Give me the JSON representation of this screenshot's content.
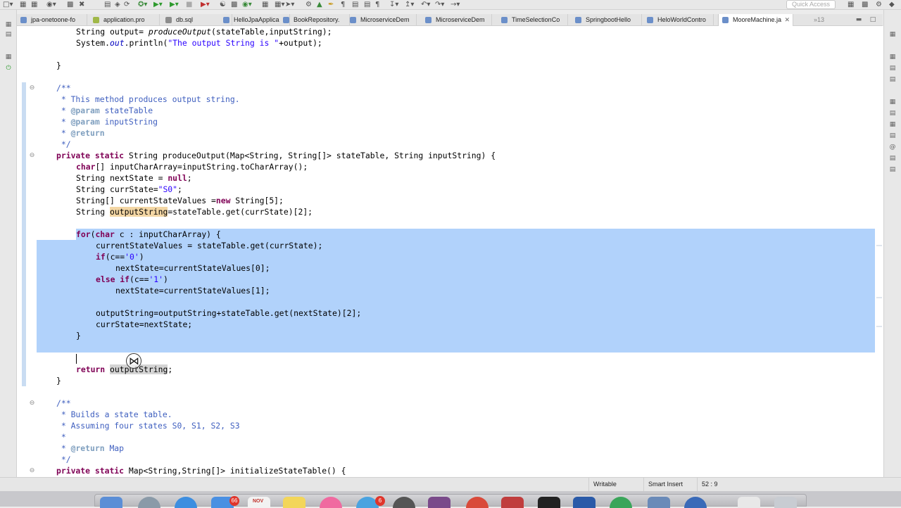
{
  "toolbar": {
    "quick_access_placeholder": "Quick Access",
    "icons": [
      "new-icon",
      "save-icon",
      "debug-icon",
      "run-icon",
      "external-tools-icon",
      "search-icon",
      "open-type-icon",
      "open-perspective-icon"
    ]
  },
  "tabs": [
    {
      "label": "jpa-onetoone-fo",
      "color": "#6b8fc9"
    },
    {
      "label": "application.pro",
      "color": "#a0b848"
    },
    {
      "label": "db.sql",
      "color": "#8c8c8c"
    },
    {
      "label": "HelloJpaApplica",
      "color": "#6b8fc9"
    },
    {
      "label": "BookRepository.",
      "color": "#6b8fc9"
    },
    {
      "label": "MicroserviceDem",
      "color": "#6b8fc9"
    },
    {
      "label": "MicroserviceDem",
      "color": "#6b8fc9"
    },
    {
      "label": "TimeSelectionCo",
      "color": "#6b8fc9"
    },
    {
      "label": "SpringbootHello",
      "color": "#6b8fc9"
    },
    {
      "label": "HeloWorldContro",
      "color": "#6b8fc9"
    },
    {
      "label": "MooreMachine.ja",
      "color": "#6b8fc9",
      "active": true
    }
  ],
  "tab_overflow": "»13",
  "code": {
    "l1_a": "String output= ",
    "l1_m": "produceOutput",
    "l1_b": "(stateTable,inputString);",
    "l2_a": "System.",
    "l2_f": "out",
    "l2_b": ".println(",
    "l2_s": "\"The output String is \"",
    "l2_c": "+output);",
    "l3": "}",
    "l4": "/**",
    "l5": " * This method produces output string.",
    "l6_tag": "@param",
    "l6_v": " stateTable",
    "l7_tag": "@param",
    "l7_v": " inputString",
    "l8_tag": "@return",
    "l9": " */",
    "l10_k1": "private",
    "l10_k2": "static",
    "l10_rest": " String produceOutput(Map<String, String[]> stateTable, String inputString) {",
    "l11_k": "char",
    "l11_rest": "[] inputCharArray=inputString.toCharArray();",
    "l12_a": "String nextState = ",
    "l12_k": "null",
    "l12_b": ";",
    "l13_a": "String currState=",
    "l13_s": "\"S0\"",
    "l13_b": ";",
    "l14_a": "String[] currentStateValues =",
    "l14_k": "new",
    "l14_b": " String[5];",
    "l15_a": "String ",
    "l15_o": "outputString",
    "l15_b": "=stateTable.get(currState)[2];",
    "l16_k1": "for",
    "l16_a": "(",
    "l16_k2": "char",
    "l16_b": " c : inputCharArray) {",
    "l17": "currentStateValues = stateTable.get(currState);",
    "l18_k": "if",
    "l18_a": "(c==",
    "l18_s": "'0'",
    "l18_b": ")",
    "l19": "nextState=currentStateValues[0];",
    "l20_k1": "else",
    "l20_k2": "if",
    "l20_a": "(c==",
    "l20_s": "'1'",
    "l20_b": ")",
    "l21": "nextState=currentStateValues[1];",
    "l22": "outputString=outputString+stateTable.get(nextState)[2];",
    "l23": "currState=nextState;",
    "l24": "}",
    "l25_k": "return",
    "l25_o": "outputString",
    "l25_b": ";",
    "l26": "}",
    "l27": "/**",
    "l28": " * Builds a state table.",
    "l29": " * Assuming four states S0, S1, S2, S3",
    "l30": " *",
    "l31_tag": "@return",
    "l31_v": " Map",
    "l32": " */",
    "l33_k1": "private",
    "l33_k2": "static",
    "l33_rest": " Map<String,String[]> initializeStateTable() {"
  },
  "status": {
    "writable": "Writable",
    "insert_mode": "Smart Insert",
    "position": "52 : 9"
  },
  "dock": {
    "mail_badge": "66",
    "calendar_label": "NOV",
    "twitter_badge": "6"
  }
}
